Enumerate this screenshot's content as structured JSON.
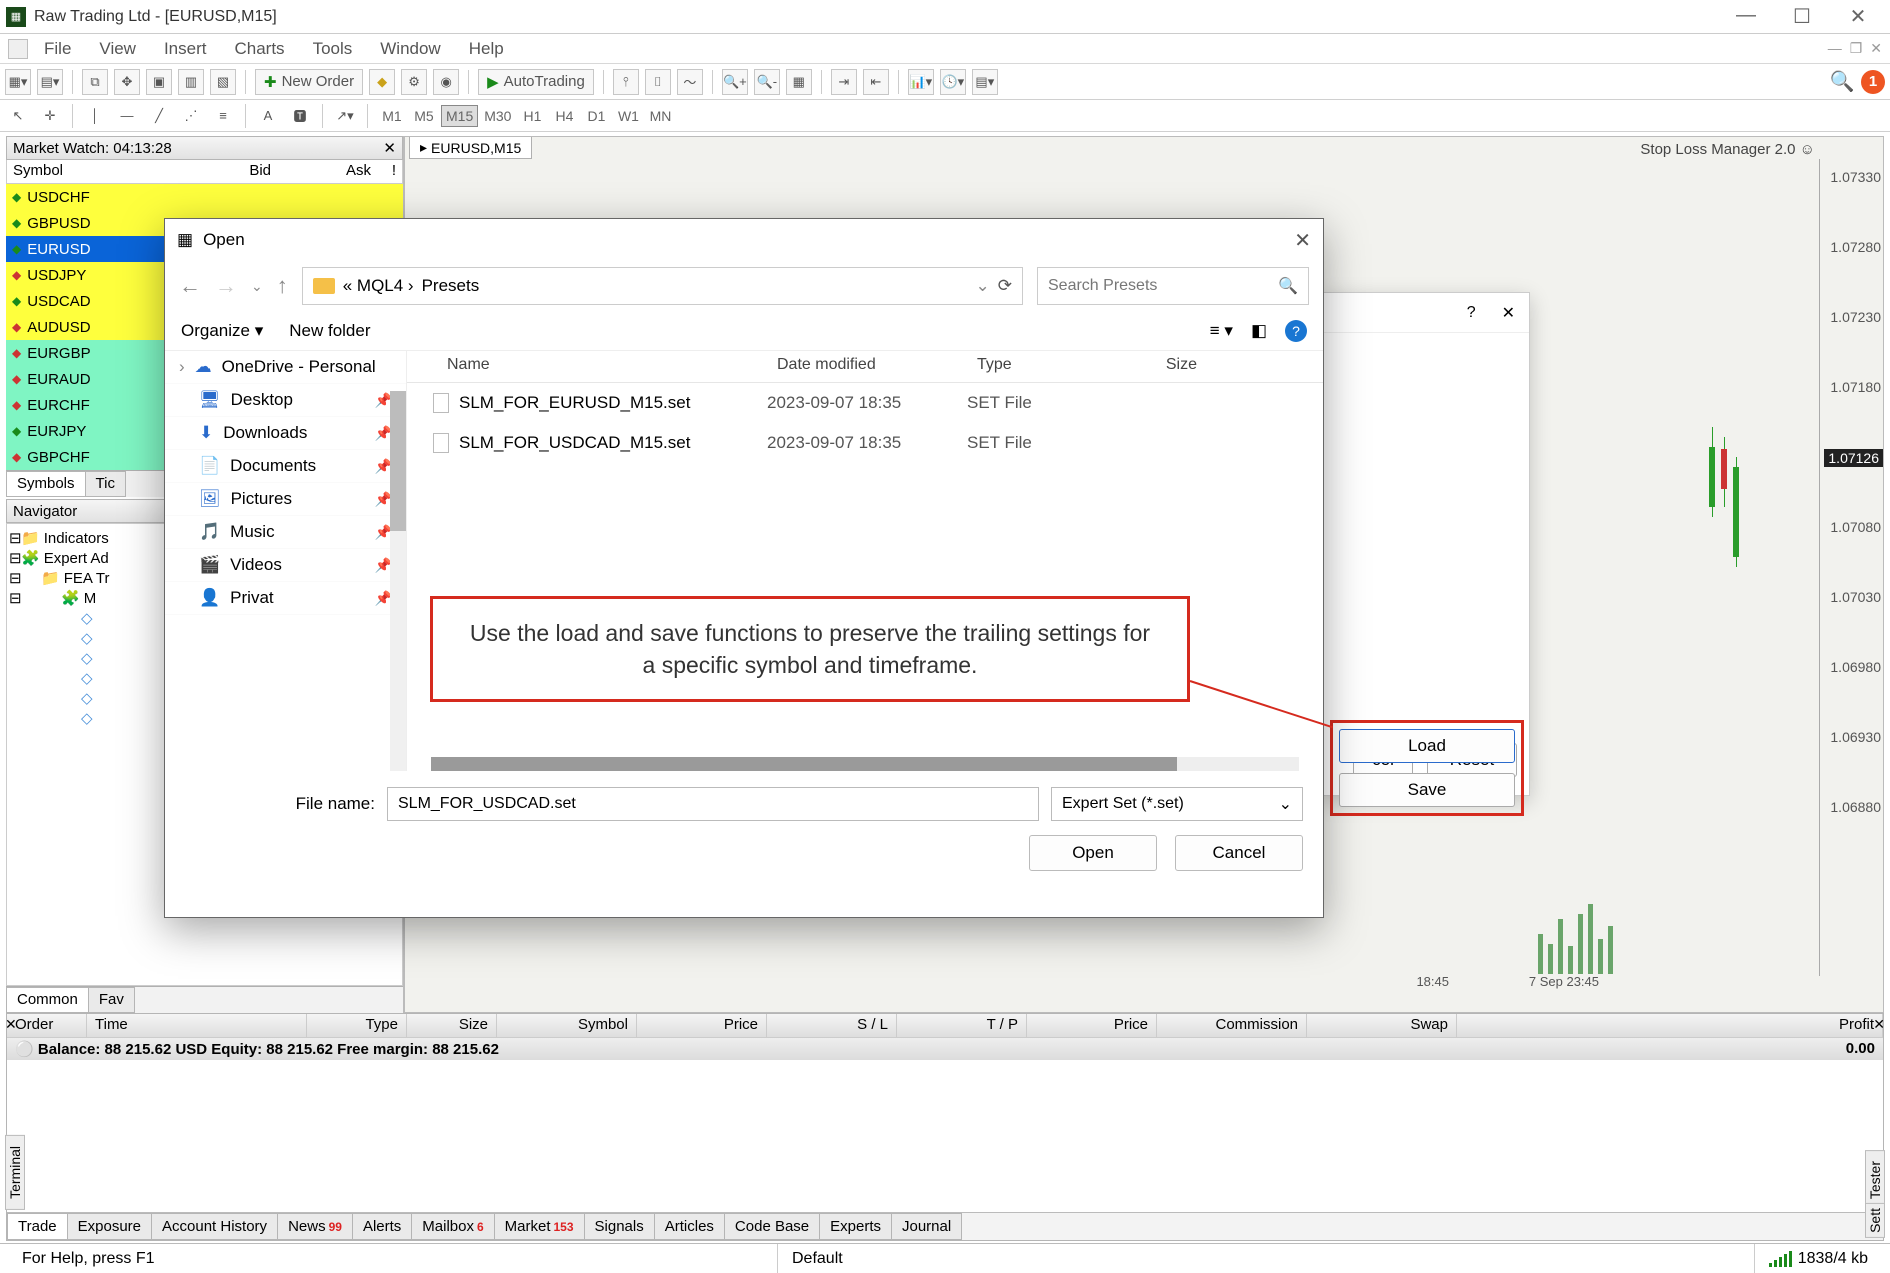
{
  "window": {
    "title": "Raw Trading Ltd - [EURUSD,M15]",
    "minimize": "—",
    "maximize": "☐",
    "close": "✕"
  },
  "menu": {
    "items": [
      "File",
      "View",
      "Insert",
      "Charts",
      "Tools",
      "Window",
      "Help"
    ]
  },
  "toolbar1": {
    "new_order": "New Order",
    "autotrading": "AutoTrading"
  },
  "timeframes": [
    "M1",
    "M5",
    "M15",
    "M30",
    "H1",
    "H4",
    "D1",
    "W1",
    "MN"
  ],
  "market_watch": {
    "title": "Market Watch: 04:13:28",
    "cols": {
      "symbol": "Symbol",
      "bid": "Bid",
      "ask": "Ask",
      "bang": "!"
    },
    "rows": [
      {
        "sym": "USDCHF",
        "cls": "sym-yellow",
        "dir": "up"
      },
      {
        "sym": "GBPUSD",
        "cls": "sym-yellow",
        "dir": "up"
      },
      {
        "sym": "EURUSD",
        "cls": "sym-blue",
        "dir": "up"
      },
      {
        "sym": "USDJPY",
        "cls": "sym-yellow",
        "dir": "dn"
      },
      {
        "sym": "USDCAD",
        "cls": "sym-yellow",
        "dir": "up"
      },
      {
        "sym": "AUDUSD",
        "cls": "sym-yellow",
        "dir": "dn"
      },
      {
        "sym": "EURGBP",
        "cls": "sym-green",
        "dir": "dn"
      },
      {
        "sym": "EURAUD",
        "cls": "sym-green",
        "dir": "dn"
      },
      {
        "sym": "EURCHF",
        "cls": "sym-green",
        "dir": "dn"
      },
      {
        "sym": "EURJPY",
        "cls": "sym-green",
        "dir": "up"
      },
      {
        "sym": "GBPCHF",
        "cls": "sym-green",
        "dir": "dn"
      }
    ],
    "tabs": [
      "Symbols",
      "Tic"
    ]
  },
  "navigator": {
    "title": "Navigator",
    "nodes": [
      "Indicators",
      "Expert Advisors",
      "FEA Tr",
      "M"
    ]
  },
  "common_tabs": [
    "Common",
    "Fav"
  ],
  "chart": {
    "tab": "EURUSD,M15",
    "ea_name": "Stop Loss Manager 2.0 ☺",
    "ticks": [
      "1.07330",
      "1.07280",
      "1.07230",
      "1.07180",
      "1.07126",
      "1.07080",
      "1.07030",
      "1.06980",
      "1.06930",
      "1.06880"
    ],
    "current": "1.07126",
    "times": [
      "18:45",
      "7 Sep 23:45"
    ]
  },
  "prop_dialog": {
    "help": "?",
    "close": "✕",
    "load": "Load",
    "save": "Save",
    "cel": "cel",
    "reset": "Reset"
  },
  "file_dialog": {
    "title": "Open",
    "path_prefix": "«  MQL4  ›",
    "path_leaf": "Presets",
    "search_placeholder": "Search Presets",
    "organize": "Organize ▾",
    "new_folder": "New folder",
    "quick": [
      {
        "label": "OneDrive - Personal",
        "icon": "cloud",
        "lead": "›"
      },
      {
        "label": "Desktop",
        "icon": "desktop"
      },
      {
        "label": "Downloads",
        "icon": "download"
      },
      {
        "label": "Documents",
        "icon": "doc"
      },
      {
        "label": "Pictures",
        "icon": "pic"
      },
      {
        "label": "Music",
        "icon": "music"
      },
      {
        "label": "Videos",
        "icon": "video"
      },
      {
        "label": "Privat",
        "icon": "priv"
      }
    ],
    "cols": {
      "name": "Name",
      "date": "Date modified",
      "type": "Type",
      "size": "Size"
    },
    "files": [
      {
        "name": "SLM_FOR_EURUSD_M15.set",
        "date": "2023-09-07 18:35",
        "type": "SET File"
      },
      {
        "name": "SLM_FOR_USDCAD_M15.set",
        "date": "2023-09-07 18:35",
        "type": "SET File"
      }
    ],
    "file_name_label": "File name:",
    "file_name_value": "SLM_FOR_USDCAD.set",
    "filter": "Expert Set (*.set)",
    "open": "Open",
    "cancel": "Cancel"
  },
  "annotation": "Use the load and save functions to preserve the trailing settings for a specific symbol and timeframe.",
  "terminal": {
    "cols": [
      "Order",
      "Time",
      "Type",
      "Size",
      "Symbol",
      "Price",
      "S / L",
      "T / P",
      "Price",
      "Commission",
      "Swap",
      "Profit"
    ],
    "balance_line": "Balance: 88 215.62 USD  Equity: 88 215.62  Free margin: 88 215.62",
    "profit": "0.00",
    "tabs": [
      {
        "l": "Trade"
      },
      {
        "l": "Exposure"
      },
      {
        "l": "Account History"
      },
      {
        "l": "News",
        "b": "99"
      },
      {
        "l": "Alerts"
      },
      {
        "l": "Mailbox",
        "b": "6"
      },
      {
        "l": "Market",
        "b": "153"
      },
      {
        "l": "Signals"
      },
      {
        "l": "Articles"
      },
      {
        "l": "Code Base"
      },
      {
        "l": "Experts"
      },
      {
        "l": "Journal"
      }
    ],
    "side_l": "Terminal",
    "side_r": "Tester",
    "side_r2": "Sett"
  },
  "status": {
    "help": "For Help, press F1",
    "profile": "Default",
    "conn": "1838/4 kb"
  }
}
